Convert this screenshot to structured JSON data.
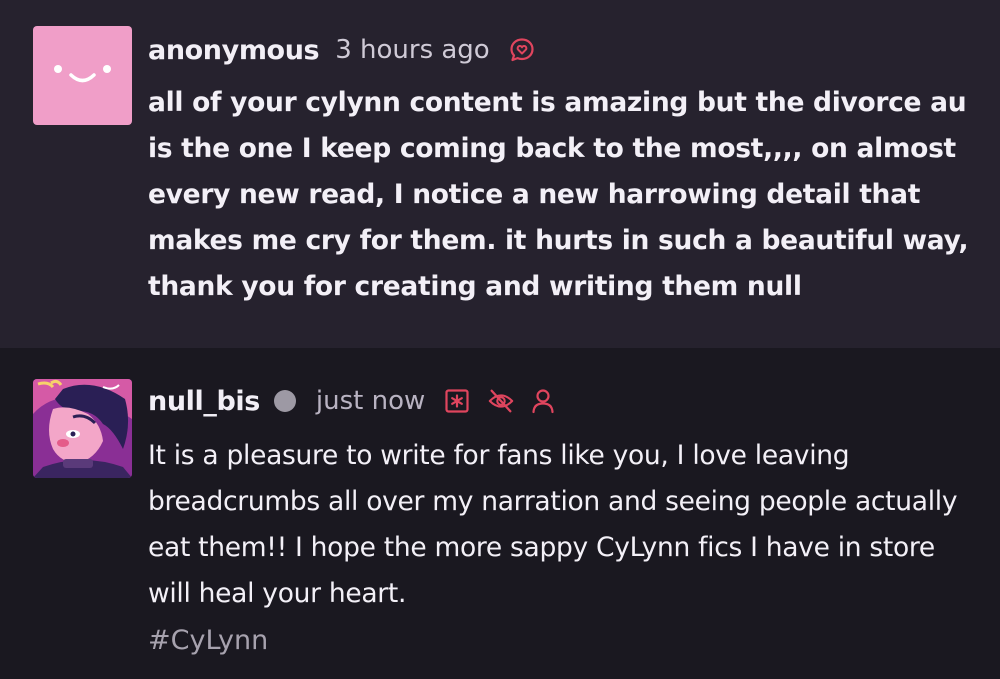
{
  "colors": {
    "ask_background": "#26222e",
    "reply_background": "#1a1820",
    "accent_red": "#e0455e",
    "anon_avatar_pink": "#f09ec8",
    "status_dot_gray": "#9d99a4"
  },
  "ask": {
    "username": "anonymous",
    "time": "3 hours ago",
    "icon": "ask-heart-bubble-icon",
    "avatar": "anonymous-smiley-avatar",
    "text": "all of your cylynn content is amazing but the divorce au is the one I keep coming back to the most,,,, on almost every new read, I notice a new harrowing detail that makes me cry for them. it hurts in such a beautiful way, thank you for creating and writing them null"
  },
  "reply": {
    "username": "null_bis",
    "time": "just now",
    "icons": [
      "content-warning-asterisk-icon",
      "hidden-eye-slash-icon",
      "user-icon"
    ],
    "avatar": "null-bis-drawn-avatar",
    "text": "It is a pleasure to write for fans like you, I love leaving breadcrumbs all over my narration and seeing people actually eat them!! I hope the more sappy CyLynn fics I have in store will heal your heart.",
    "tag": "#CyLynn"
  }
}
